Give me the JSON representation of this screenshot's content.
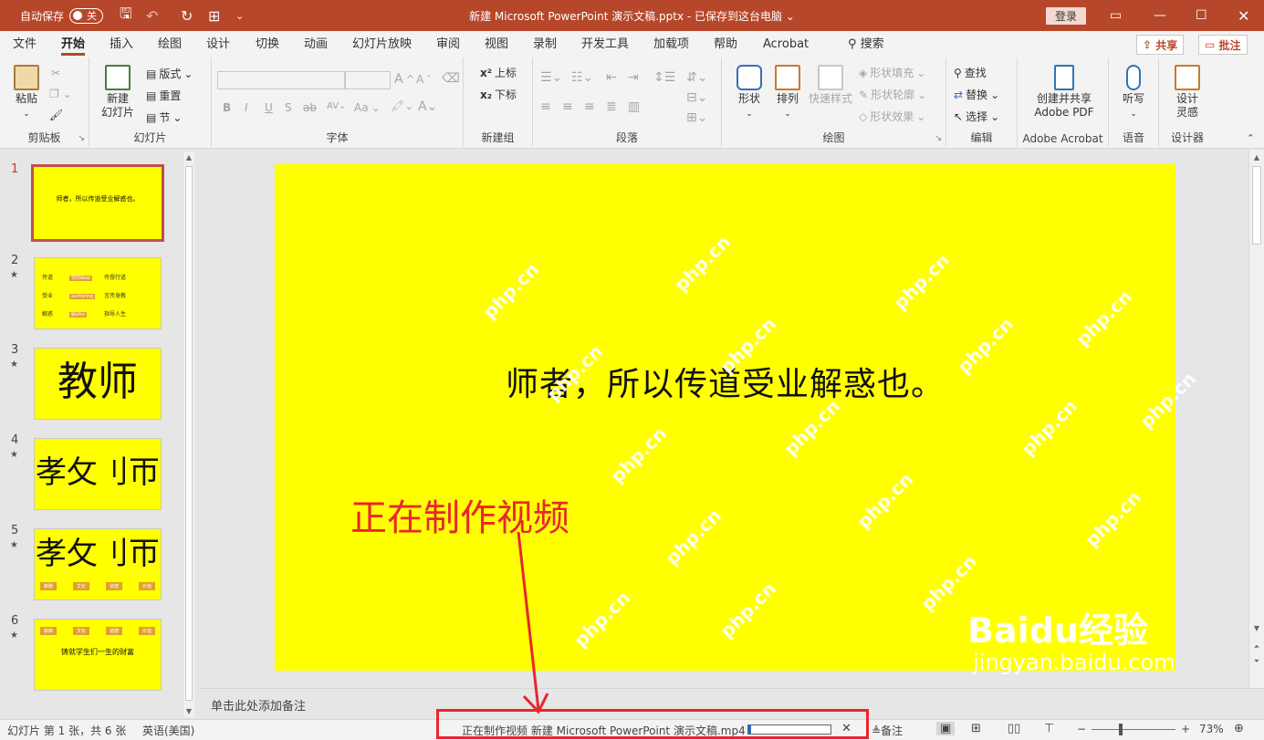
{
  "titlebar": {
    "autosave_label": "自动保存",
    "autosave_state": "关",
    "title": "新建 Microsoft PowerPoint 演示文稿.pptx - 已保存到这台电脑 ⌄",
    "login": "登录",
    "accent": "#b7472a"
  },
  "tabs": [
    "文件",
    "开始",
    "插入",
    "绘图",
    "设计",
    "切换",
    "动画",
    "幻灯片放映",
    "审阅",
    "视图",
    "录制",
    "开发工具",
    "加载项",
    "帮助",
    "Acrobat"
  ],
  "search_label": "搜索",
  "share_label": "共享",
  "comment_label": "批注",
  "ribbon": {
    "clipboard": {
      "paste": "粘贴",
      "label": "剪贴板"
    },
    "slides": {
      "new_slide": "新建\n幻灯片",
      "layout": "版式",
      "reset": "重置",
      "section": "节",
      "label": "幻灯片"
    },
    "font": {
      "bold": "B",
      "italic": "I",
      "underline": "U",
      "shadow": "S",
      "strike": "ab",
      "case": "Aa",
      "grow": "A",
      "shrink": "A",
      "label": "字体"
    },
    "newgroup": {
      "superscript": "上标",
      "subscript": "下标",
      "label": "新建组"
    },
    "paragraph": {
      "label": "段落"
    },
    "drawing": {
      "shapes": "形状",
      "arrange": "排列",
      "quick_styles": "快速样式",
      "fill": "形状填充",
      "outline": "形状轮廓",
      "effects": "形状效果",
      "label": "绘图"
    },
    "editing": {
      "find": "查找",
      "replace": "替换",
      "select": "选择",
      "label": "编辑"
    },
    "acrobat": {
      "create": "创建并共享\nAdobe PDF",
      "label": "Adobe Acrobat"
    },
    "voice": {
      "dictate": "听写",
      "label": "语音"
    },
    "designer": {
      "ideas": "设计\n灵感",
      "label": "设计器"
    }
  },
  "thumbnails": [
    {
      "num": "1",
      "star": "",
      "text": "师者，所以传道受业解惑也。"
    },
    {
      "num": "2",
      "star": "★",
      "rows": [
        [
          "传道",
          "导向dear",
          "传授行道"
        ],
        [
          "受业",
          "authoring",
          "言传身教"
        ],
        [
          "解惑",
          "解afro",
          "指导人生"
        ]
      ]
    },
    {
      "num": "3",
      "star": "★",
      "text": "教师"
    },
    {
      "num": "4",
      "star": "★",
      "text": "孝攵刂帀"
    },
    {
      "num": "5",
      "star": "★",
      "text": "孝攵刂帀",
      "chips": [
        "薪酬",
        "文化",
        "道德",
        "价值"
      ]
    },
    {
      "num": "6",
      "star": "★",
      "chips": [
        "薪酬",
        "文化",
        "道德",
        "价值"
      ],
      "text": "铸就学生们一生的财富"
    }
  ],
  "slide": {
    "text": "师者，所以传道受业解惑也。",
    "watermark": "php.cn",
    "bg": "#ffff00"
  },
  "notes_placeholder": "单击此处添加备注",
  "status": {
    "slide_info": "幻灯片 第 1 张，共 6 张",
    "language": "英语(美国)",
    "export": "正在制作视频 新建 Microsoft PowerPoint 演示文稿.mp4",
    "export_progress": 0.03,
    "notes": "备注",
    "zoom": "73%"
  },
  "annotation": {
    "text": "正在制作视频",
    "color": "#e8262e"
  },
  "baidu_brand": {
    "logo": "Baidu经验",
    "url": "jingyan.baidu.com"
  }
}
